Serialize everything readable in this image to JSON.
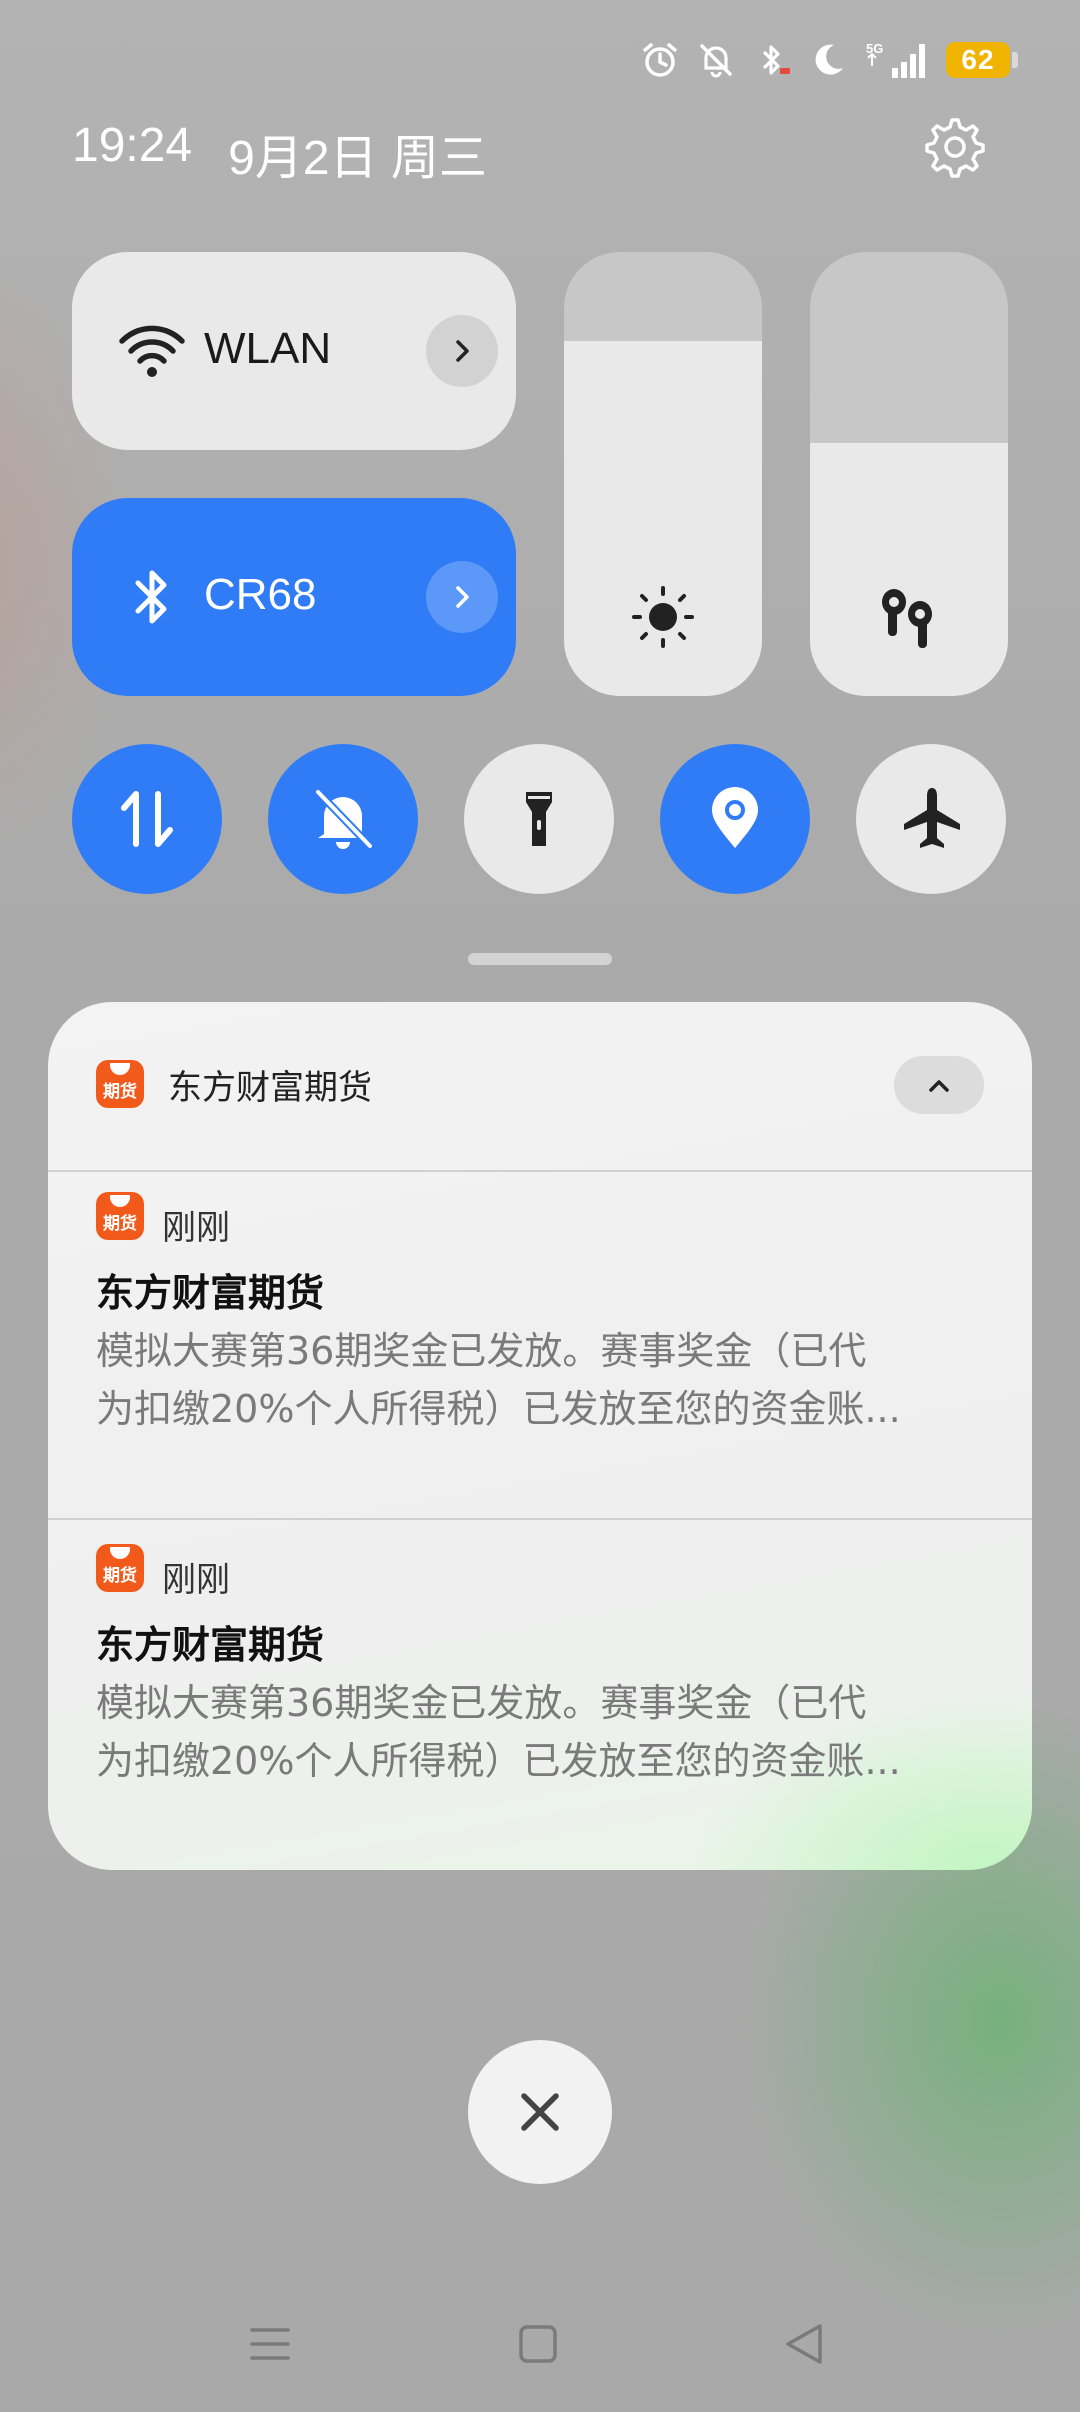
{
  "status_bar": {
    "network_type": "5G",
    "battery_level": "62",
    "battery_color": "#f0b400"
  },
  "header": {
    "time": "19:24",
    "date": "9月2日 周三"
  },
  "quick_tiles": {
    "wlan_label": "WLAN",
    "bluetooth_label": "CR68",
    "accent_color": "#2f7cf6"
  },
  "sliders": {
    "brightness_level": 0.8,
    "volume_level": 0.57
  },
  "toggles": [
    {
      "name": "mobile-data",
      "state": "on"
    },
    {
      "name": "do-not-disturb",
      "state": "on"
    },
    {
      "name": "flashlight",
      "state": "off"
    },
    {
      "name": "location",
      "state": "on"
    },
    {
      "name": "airplane-mode",
      "state": "off"
    }
  ],
  "notification_group": {
    "app_name": "东方财富期货",
    "app_icon_text": "期货",
    "app_icon_color": "#f25a1c",
    "notifications": [
      {
        "time": "刚刚",
        "title": "东方财富期货",
        "body_line1": "模拟大赛第36期奖金已发放。赛事奖金（已代",
        "body_line2": "为扣缴20%个人所得税）已发放至您的资金账..."
      },
      {
        "time": "刚刚",
        "title": "东方财富期货",
        "body_line1": "模拟大赛第36期奖金已发放。赛事奖金（已代",
        "body_line2": "为扣缴20%个人所得税）已发放至您的资金账..."
      }
    ]
  }
}
